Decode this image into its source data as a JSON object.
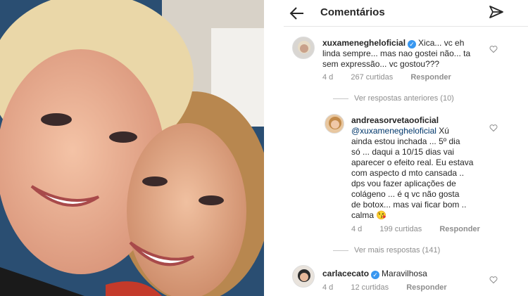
{
  "header": {
    "title": "Comentários"
  },
  "comment1": {
    "username": "xuxamenegheloficial",
    "text": "Xica... vc eh linda sempre... mas nao gostei não... ta sem expressão... vc gostou???",
    "line1": "Xica... vc eh",
    "line2": "linda sempre... mas nao gostei não... ta",
    "line3": "sem expressão... vc gostou???",
    "time": "4 d",
    "likes": "267 curtidas",
    "reply": "Responder"
  },
  "view_previous": "Ver respostas anteriores (10)",
  "reply1": {
    "username": "andreasorvetaooficial",
    "mention": "@xuxamenegheloficial",
    "lines": [
      "ainda estou inchada ... 5º dia",
      "só ... daqui a 10/15 dias vai",
      "aparecer o efeito real.  Eu estava",
      "com aspecto d mto cansada ..",
      "dps vou fazer aplicações de",
      "colágeno ... é q vc não gosta",
      "de botox... mas vai ficar bom ..",
      "calma 😘"
    ],
    "first_tail": "Xú",
    "time": "4 d",
    "likes": "199 curtidas",
    "reply": "Responder"
  },
  "view_more": "Ver mais respostas (141)",
  "comment2": {
    "username": "carlacecato",
    "text": "Maravilhosa",
    "time": "4 d",
    "likes": "12 curtidas",
    "reply": "Responder"
  },
  "colors": {
    "verified": "#3897f0",
    "meta": "#8e8e8e"
  }
}
